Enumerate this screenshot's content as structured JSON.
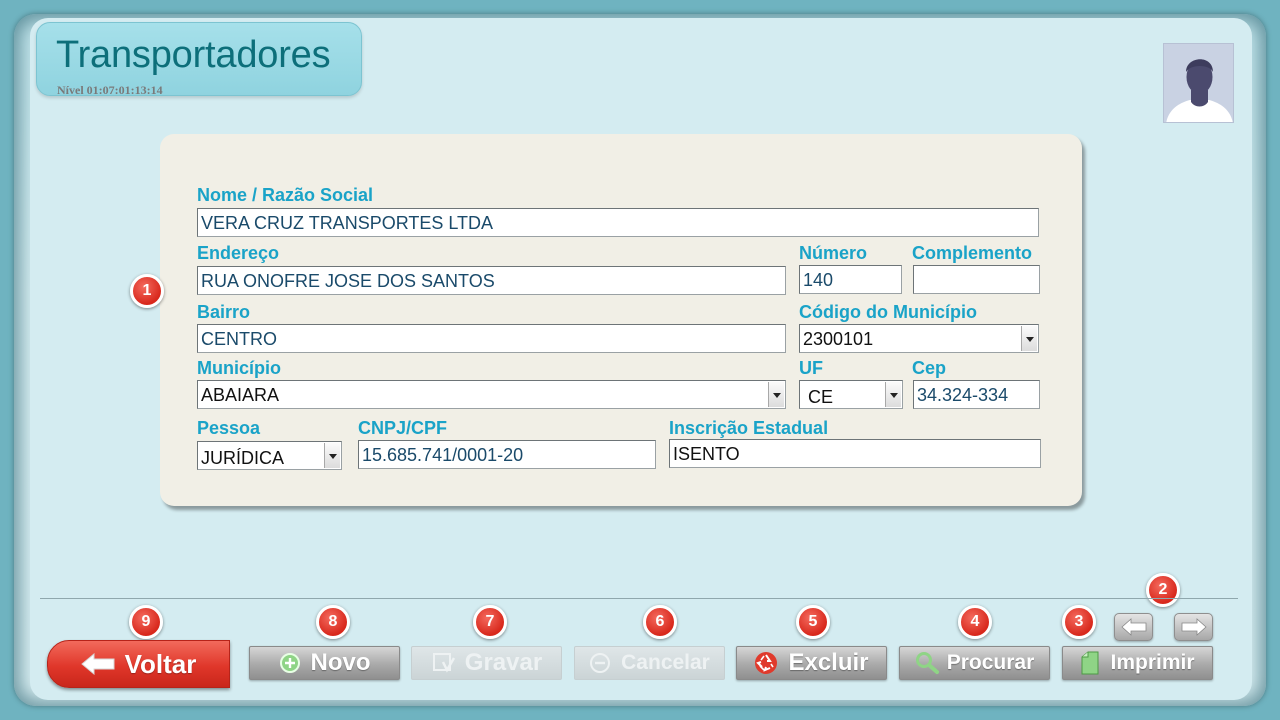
{
  "header": {
    "title": "Transportadores",
    "level": "Nível 01:07:01:13:14"
  },
  "form": {
    "nome": {
      "label": "Nome / Razão Social",
      "value": "VERA CRUZ TRANSPORTES LTDA"
    },
    "endereco": {
      "label": "Endereço",
      "value": "RUA ONOFRE JOSE DOS SANTOS"
    },
    "numero": {
      "label": "Número",
      "value": "140"
    },
    "complemento": {
      "label": "Complemento",
      "value": ""
    },
    "bairro": {
      "label": "Bairro",
      "value": "CENTRO"
    },
    "codigo_municipio": {
      "label": "Código do Município",
      "value": "2300101"
    },
    "municipio": {
      "label": "Município",
      "value": "ABAIARA"
    },
    "uf": {
      "label": "UF",
      "value": "CE"
    },
    "cep": {
      "label": "Cep",
      "value": "34.324-334"
    },
    "pessoa": {
      "label": "Pessoa",
      "value": "JURÍDICA"
    },
    "cnpj": {
      "label": "CNPJ/CPF",
      "value": "15.685.741/0001-20"
    },
    "inscricao": {
      "label": "Inscrição Estadual",
      "value": "ISENTO"
    }
  },
  "badges": {
    "b1": "1",
    "b2": "2",
    "b3": "3",
    "b4": "4",
    "b5": "5",
    "b6": "6",
    "b7": "7",
    "b8": "8",
    "b9": "9"
  },
  "toolbar": {
    "voltar": "Voltar",
    "novo": "Novo",
    "gravar": "Gravar",
    "cancelar": "Cancelar",
    "excluir": "Excluir",
    "procurar": "Procurar",
    "imprimir": "Imprimir"
  },
  "colors": {
    "accent": "#1aa3c8",
    "title": "#0d6f7a",
    "badge": "#d8281c",
    "voltar": "#e0372a"
  },
  "icons": [
    "user-avatar-icon",
    "arrow-left-icon",
    "plus-circle-icon",
    "save-icon",
    "minus-circle-icon",
    "recycle-icon",
    "magnifier-icon",
    "document-icon",
    "nav-left-icon",
    "nav-right-icon"
  ]
}
